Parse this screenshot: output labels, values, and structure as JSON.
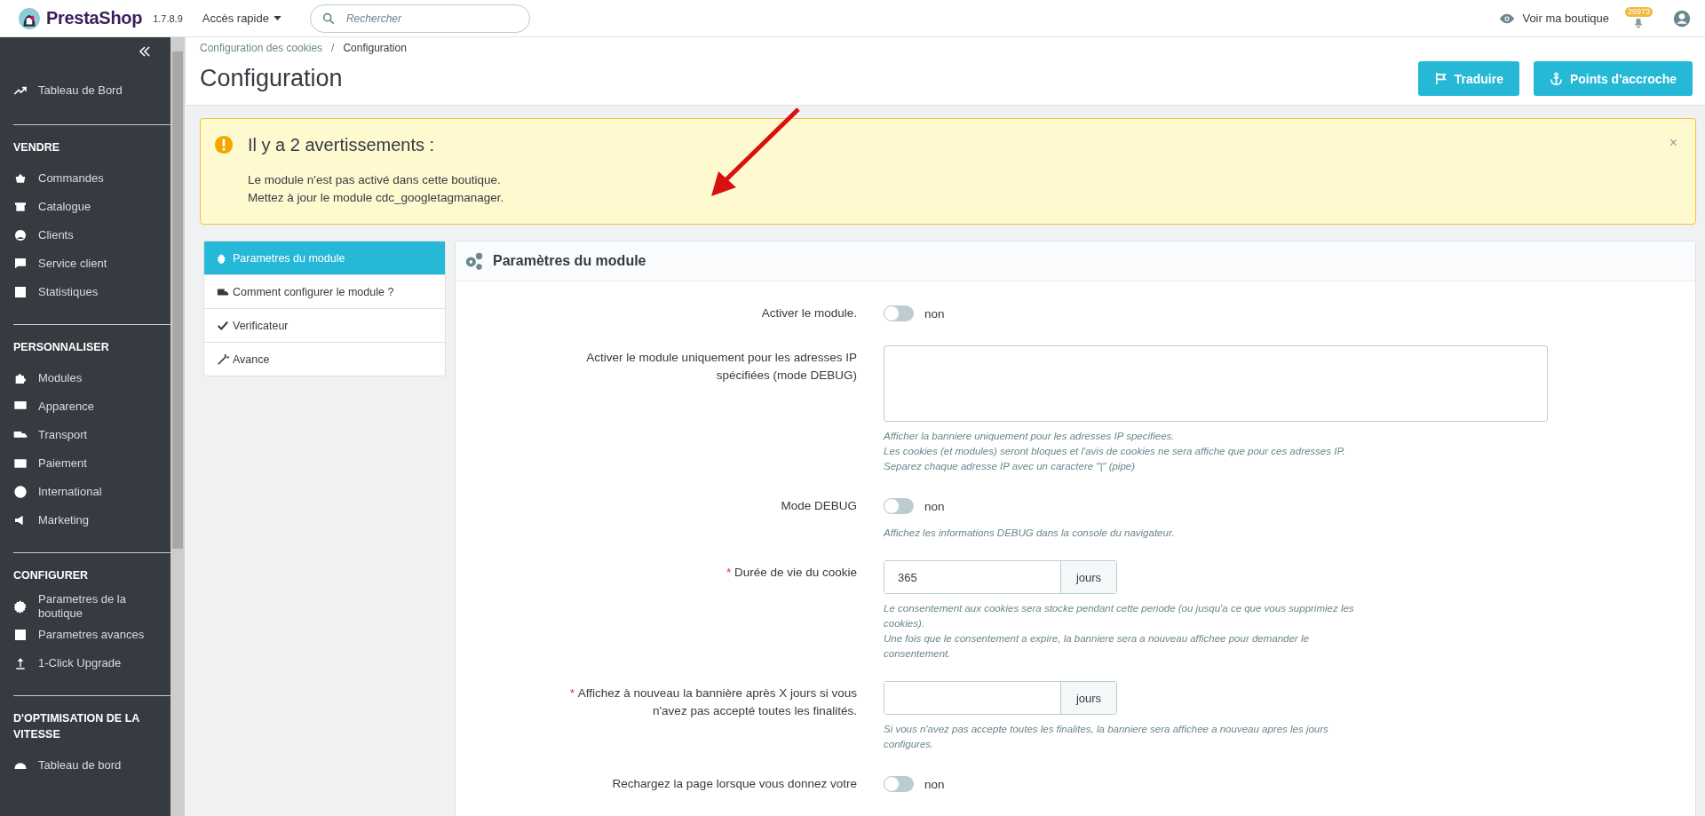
{
  "header": {
    "brand": "PrestaShop",
    "version": "1.7.8.9",
    "quick_access": "Accès rapide",
    "search": {
      "placeholder": "Rechercher"
    },
    "view_shop": "Voir ma boutique",
    "notifications": "26973"
  },
  "sidebar": {
    "top_item": "Tableau de Bord",
    "sections": [
      {
        "title": "VENDRE",
        "items": [
          "Commandes",
          "Catalogue",
          "Clients",
          "Service client",
          "Statistiques"
        ]
      },
      {
        "title": "PERSONNALISER",
        "items": [
          "Modules",
          "Apparence",
          "Transport",
          "Paiement",
          "International",
          "Marketing"
        ]
      },
      {
        "title": "CONFIGURER",
        "items": [
          "Parametres de la boutique",
          "Parametres avances",
          "1-Click Upgrade"
        ]
      },
      {
        "title": "D'OPTIMISATION DE LA VITESSE",
        "items": [
          "Tableau de bord"
        ]
      }
    ]
  },
  "breadcrumb": [
    "Configuration des cookies",
    "Configuration"
  ],
  "breadcrumb_separator": "/",
  "page_title": "Configuration",
  "toolbar_buttons": [
    "Traduire",
    "Points d'accroche"
  ],
  "alert": {
    "title": "Il y a 2 avertissements :",
    "messages": [
      "Le module n'est pas activé dans cette boutique.",
      "Mettez à jour le module cdc_googletagmanager."
    ],
    "close": "×"
  },
  "tabs": [
    {
      "label": "Parametres du module",
      "selected": true
    },
    {
      "label": "Comment configurer le module ?",
      "selected": false
    },
    {
      "label": "Verificateur",
      "selected": false
    },
    {
      "label": "Avance",
      "selected": false
    }
  ],
  "panel": {
    "title": "Paramètres du module",
    "required_mark": "*",
    "rows": [
      {
        "kind": "toggle",
        "label": "Activer le module.",
        "required": false,
        "on": false,
        "state_label": "non"
      },
      {
        "kind": "textarea",
        "label": "Activer le module uniquement pour les adresses IP spécifiées (mode DEBUG)",
        "required": false,
        "hint": [
          "Afficher la banniere uniquement pour les adresses IP specifiees.",
          "Les cookies (et modules) seront bloques et l'avis de cookies ne sera affiche que pour ces adresses IP.",
          "Separez chaque adresse IP avec un caractere \"|\" (pipe)"
        ]
      },
      {
        "kind": "toggle",
        "label": "Mode DEBUG",
        "required": false,
        "on": false,
        "state_label": "non",
        "hint": [
          "Affichez les informations DEBUG dans la console du navigateur."
        ]
      },
      {
        "kind": "input",
        "label": "Durée de vie du cookie",
        "required": true,
        "value": "365",
        "addon": "jours",
        "hint": [
          "Le consentement aux cookies sera stocke pendant cette periode (ou jusqu'a ce que vous supprimiez les cookies).",
          "Une fois que le consentement a expire, la banniere sera a nouveau affichee pour demander le consentement."
        ]
      },
      {
        "kind": "input",
        "label": "Affichez à nouveau la bannière après X jours si vous n'avez pas accepté toutes les finalités.",
        "required": true,
        "value": "",
        "addon": "jours",
        "hint": [
          "Si vous n'avez pas accepte toutes les finalites, la banniere sera affichee a nouveau apres les jours configures."
        ]
      },
      {
        "kind": "toggle",
        "label": "Rechargez la page lorsque vous donnez votre",
        "required": false,
        "on": false,
        "state_label": "non"
      }
    ]
  }
}
